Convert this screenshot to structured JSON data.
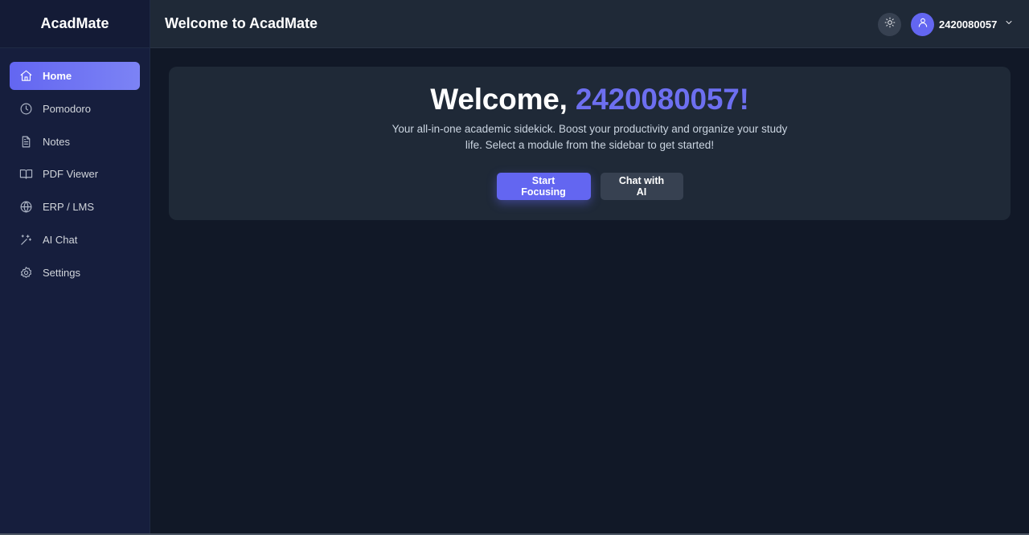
{
  "app": {
    "brand": "AcadMate"
  },
  "sidebar": {
    "items": [
      {
        "label": "Home",
        "icon": "home-icon",
        "active": true
      },
      {
        "label": "Pomodoro",
        "icon": "clock-icon",
        "active": false
      },
      {
        "label": "Notes",
        "icon": "file-text-icon",
        "active": false
      },
      {
        "label": "PDF Viewer",
        "icon": "book-open-icon",
        "active": false
      },
      {
        "label": "ERP / LMS",
        "icon": "globe-icon",
        "active": false
      },
      {
        "label": "AI Chat",
        "icon": "sparkles-icon",
        "active": false
      },
      {
        "label": "Settings",
        "icon": "gear-icon",
        "active": false
      }
    ]
  },
  "header": {
    "title": "Welcome to AcadMate",
    "theme_toggle_icon": "sun-icon",
    "username": "2420080057"
  },
  "main": {
    "welcome_prefix": "Welcome, ",
    "welcome_user": "2420080057!",
    "description": "Your all-in-one academic sidekick. Boost your productivity and organize your study life. Select a module from the sidebar to get started!",
    "primary_button": "Start Focusing",
    "secondary_button": "Chat with AI"
  },
  "colors": {
    "accent": "#6366f1",
    "sidebar_bg": "#161e3d",
    "main_bg": "#111827",
    "card_bg": "#1f2937"
  }
}
